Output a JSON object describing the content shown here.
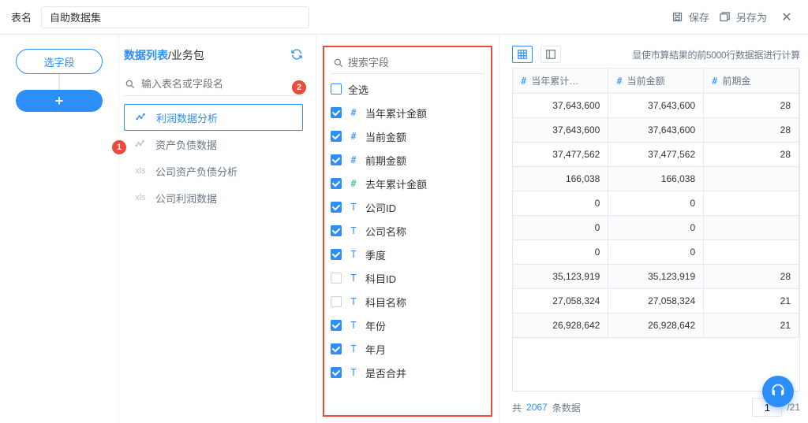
{
  "top": {
    "label": "表名",
    "name": "自助数据集",
    "save": "保存",
    "save_as": "另存为"
  },
  "left": {
    "select_fields": "选字段",
    "plus": "+"
  },
  "mid": {
    "title_a": "数据列表",
    "title_sep": "/",
    "title_b": "业务包",
    "badge_refresh": "2",
    "badge_item": "1",
    "search_ph": "输入表名或字段名",
    "items": [
      {
        "type": "chart",
        "label": "利润数据分析",
        "sel": true
      },
      {
        "type": "chart",
        "label": "资产负债数据"
      },
      {
        "type": "xls",
        "label": "公司资产负债分析"
      },
      {
        "type": "xls",
        "label": "公司利润数据"
      }
    ]
  },
  "fields": {
    "search_ph": "搜索字段",
    "all_label": "全选",
    "rows": [
      {
        "cb": true,
        "t": "hash",
        "label": "当年累计金额"
      },
      {
        "cb": true,
        "t": "hash",
        "label": "当前金额"
      },
      {
        "cb": true,
        "t": "hash",
        "label": "前期金额"
      },
      {
        "cb": true,
        "t": "hash",
        "g": true,
        "label": "去年累计金额"
      },
      {
        "cb": true,
        "t": "txt",
        "label": "公司ID"
      },
      {
        "cb": true,
        "t": "txt",
        "label": "公司名称"
      },
      {
        "cb": true,
        "t": "txt",
        "label": "季度"
      },
      {
        "cb": false,
        "t": "txt",
        "label": "科目ID"
      },
      {
        "cb": false,
        "t": "txt",
        "label": "科目名称"
      },
      {
        "cb": true,
        "t": "txt",
        "label": "年份"
      },
      {
        "cb": true,
        "t": "txt",
        "label": "年月"
      },
      {
        "cb": true,
        "t": "txt",
        "label": "是否合并"
      }
    ]
  },
  "right": {
    "msg": "显使市算結果的前5000行数据据进行计算",
    "cols": [
      "当年累计…",
      "当前金额",
      "前期金"
    ],
    "rows": [
      [
        "37,643,600",
        "37,643,600",
        "28"
      ],
      [
        "37,643,600",
        "37,643,600",
        "28"
      ],
      [
        "37,477,562",
        "37,477,562",
        "28"
      ],
      [
        "166,038",
        "166,038",
        ""
      ],
      [
        "0",
        "0",
        ""
      ],
      [
        "0",
        "0",
        ""
      ],
      [
        "0",
        "0",
        ""
      ],
      [
        "35,123,919",
        "35,123,919",
        "28"
      ],
      [
        "27,058,324",
        "27,058,324",
        "21"
      ],
      [
        "26,928,642",
        "26,928,642",
        "21"
      ]
    ],
    "foot_prefix": "共",
    "foot_count": "2067",
    "foot_suffix": "条数据",
    "page": "1",
    "page_total": "/21"
  }
}
